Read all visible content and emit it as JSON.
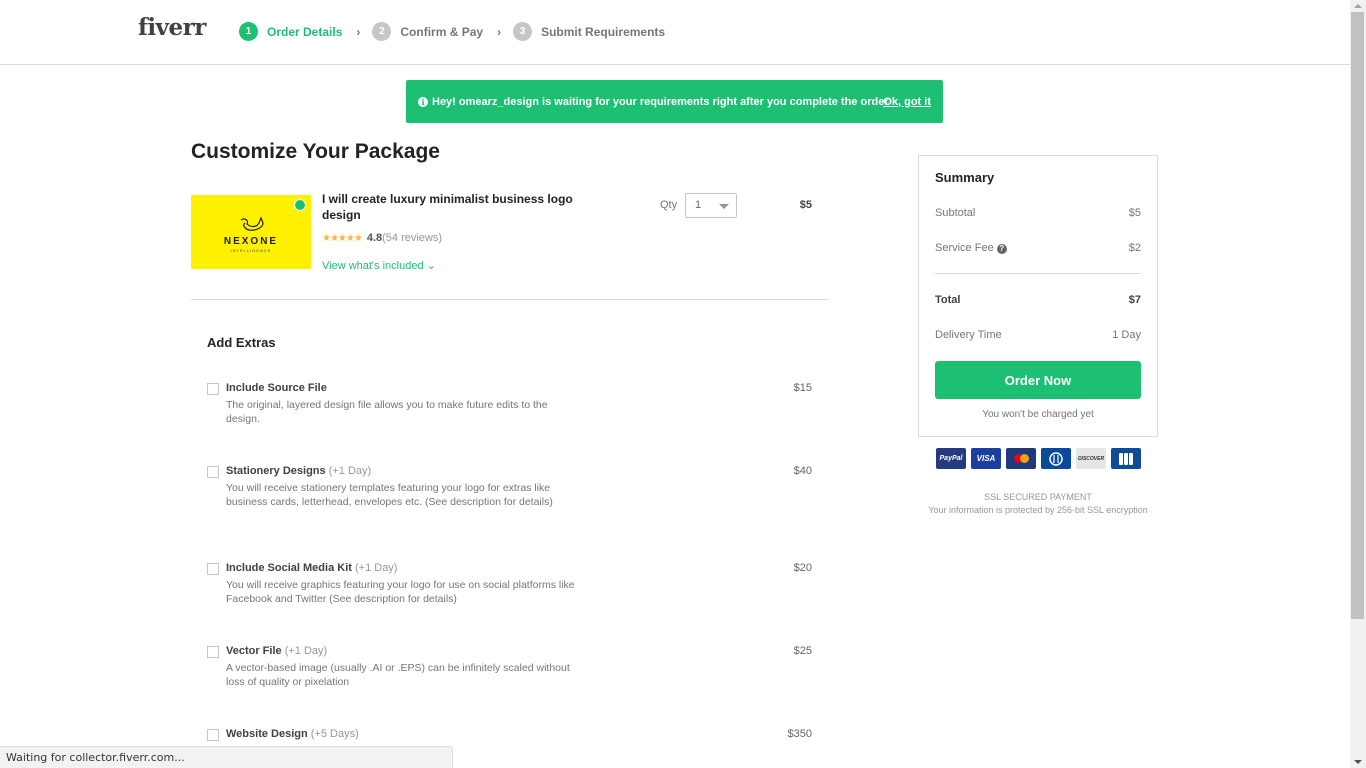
{
  "header": {
    "logo": "fiverr",
    "steps": [
      {
        "number": "1",
        "label": "Order Details",
        "active": true
      },
      {
        "number": "2",
        "label": "Confirm & Pay",
        "active": false
      },
      {
        "number": "3",
        "label": "Submit Requirements",
        "active": false
      }
    ],
    "separator": "›"
  },
  "banner": {
    "info_icon": "i",
    "message": "Hey! omearz_design is waiting for your requirements right after you complete the order",
    "dismiss": "Ok, got it"
  },
  "package": {
    "title": "Customize Your Package",
    "gig": {
      "thumbnail_brand": "NEXONE",
      "thumbnail_sub": "INTELLIGENCE",
      "title": "I will create luxury minimalist business logo design",
      "stars": "★★★★★",
      "rating": "4.8",
      "reviews": "(54 reviews)",
      "view_included": "View what's included ⌄",
      "qty_label": "Qty",
      "qty_value": "1",
      "price": "$5"
    }
  },
  "extras": {
    "title": "Add Extras",
    "items": [
      {
        "name": "Include Source File",
        "days": "",
        "desc": "The original, layered design file allows you to make future edits to the design.",
        "price": "$15",
        "checked": false
      },
      {
        "name": "Stationery Designs",
        "days": "(+1 Day)",
        "desc": "You will receive stationery templates featuring your logo for extras like business cards, letterhead, envelopes etc. (See description for details)",
        "price": "$40",
        "checked": false
      },
      {
        "name": "Include Social Media Kit",
        "days": "(+1 Day)",
        "desc": "You will receive graphics featuring your logo for use on social platforms like Facebook and Twitter (See description for details)",
        "price": "$20",
        "checked": false
      },
      {
        "name": "Vector File",
        "days": "(+1 Day)",
        "desc": "A vector-based image (usually .AI or .EPS) can be infinitely scaled without loss of quality or pixelation",
        "price": "$25",
        "checked": false
      },
      {
        "name": "Website Design",
        "days": "(+5 Days)",
        "desc": "",
        "price": "$350",
        "checked": false
      }
    ]
  },
  "summary": {
    "title": "Summary",
    "subtotal_label": "Subtotal",
    "subtotal": "$5",
    "service_fee_label": "Service Fee",
    "service_fee": "$2",
    "help_icon": "?",
    "total_label": "Total",
    "total": "$7",
    "delivery_label": "Delivery Time",
    "delivery": "1 Day",
    "order_button": "Order Now",
    "note": "You won't be charged yet"
  },
  "payments": {
    "methods": [
      "PayPal",
      "VISA",
      "MasterCard",
      "Diners Club",
      "DISCOVER",
      "JCB"
    ]
  },
  "ssl": {
    "title": "SSL SECURED PAYMENT",
    "text": "Your information is protected by 256-bit SSL encryption"
  },
  "status_bar": {
    "text": "Waiting for collector.fiverr.com..."
  },
  "colors": {
    "brand": "#1dbf73",
    "stars": "#ffb33e",
    "text": "#404145"
  }
}
